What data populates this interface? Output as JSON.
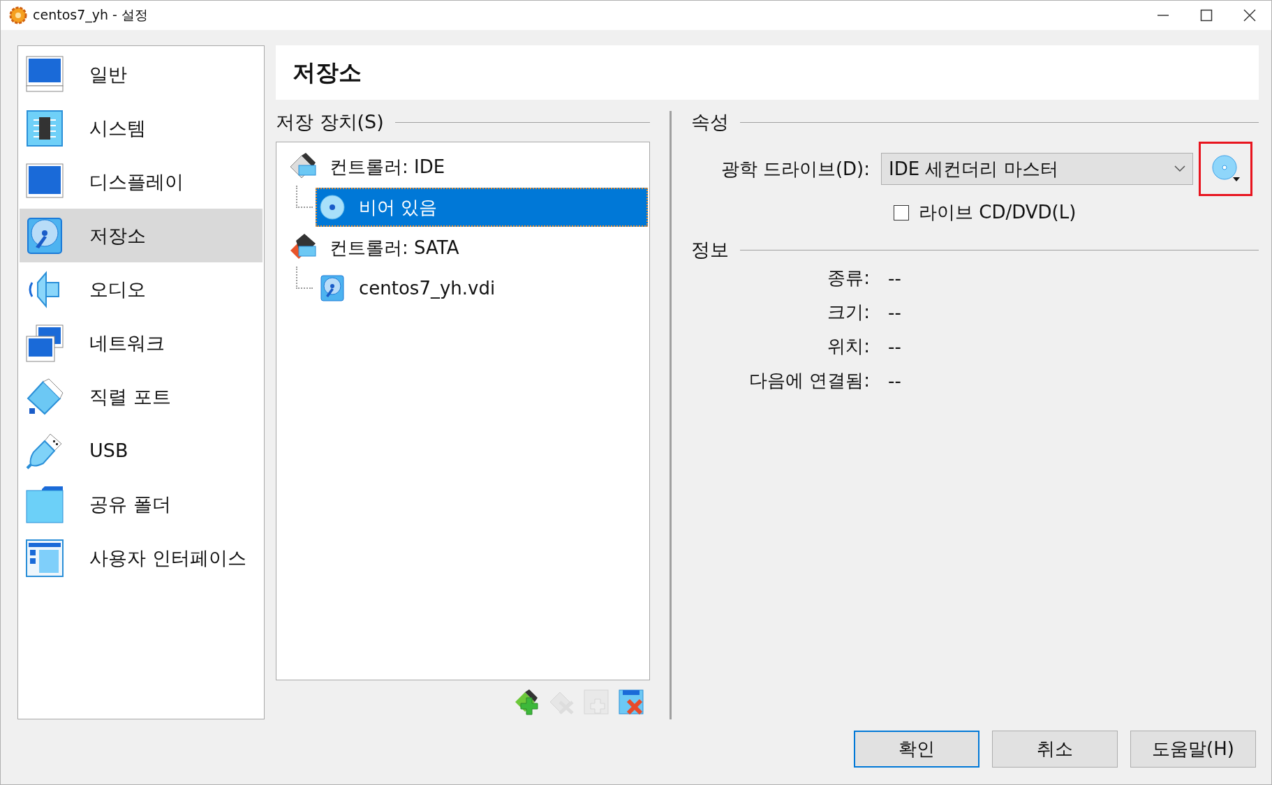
{
  "window": {
    "title": "centos7_yh - 설정"
  },
  "sidebar": {
    "items": [
      {
        "label": "일반",
        "kind": "general",
        "selected": false
      },
      {
        "label": "시스템",
        "kind": "system",
        "selected": false
      },
      {
        "label": "디스플레이",
        "kind": "display",
        "selected": false
      },
      {
        "label": "저장소",
        "kind": "storage",
        "selected": true
      },
      {
        "label": "오디오",
        "kind": "audio",
        "selected": false
      },
      {
        "label": "네트워크",
        "kind": "network",
        "selected": false
      },
      {
        "label": "직렬 포트",
        "kind": "serial",
        "selected": false
      },
      {
        "label": "USB",
        "kind": "usb",
        "selected": false
      },
      {
        "label": "공유 폴더",
        "kind": "folder",
        "selected": false
      },
      {
        "label": "사용자 인터페이스",
        "kind": "ui",
        "selected": false
      }
    ]
  },
  "page_title": "저장소",
  "storage": {
    "title": "저장 장치(S)",
    "tree": [
      {
        "label": "컨트롤러: IDE",
        "kind": "ide",
        "selected": false,
        "children": [
          {
            "label": "비어 있음",
            "kind": "optical",
            "selected": true
          }
        ]
      },
      {
        "label": "컨트롤러: SATA",
        "kind": "sata",
        "selected": false,
        "children": [
          {
            "label": "centos7_yh.vdi",
            "kind": "disk",
            "selected": false
          }
        ]
      }
    ],
    "toolbar": [
      {
        "kind": "add-controller",
        "disabled": false
      },
      {
        "kind": "remove-controller",
        "disabled": true
      },
      {
        "kind": "add-attachment",
        "disabled": true
      },
      {
        "kind": "remove-attachment",
        "disabled": false
      }
    ]
  },
  "attributes": {
    "title": "속성",
    "drive_label": "광학 드라이브(D):",
    "drive_value": "IDE 세컨더리 마스터",
    "live_cd": {
      "label": "라이브 CD/DVD(L)",
      "checked": false
    }
  },
  "info": {
    "title": "정보",
    "rows": [
      {
        "label": "종류:",
        "value": "--"
      },
      {
        "label": "크기:",
        "value": "--"
      },
      {
        "label": "위치:",
        "value": "--"
      },
      {
        "label": "다음에 연결됨:",
        "value": "--"
      }
    ]
  },
  "buttons": [
    {
      "label": "확인",
      "default": true
    },
    {
      "label": "취소",
      "default": false
    },
    {
      "label": "도움말(H)",
      "default": false
    }
  ]
}
